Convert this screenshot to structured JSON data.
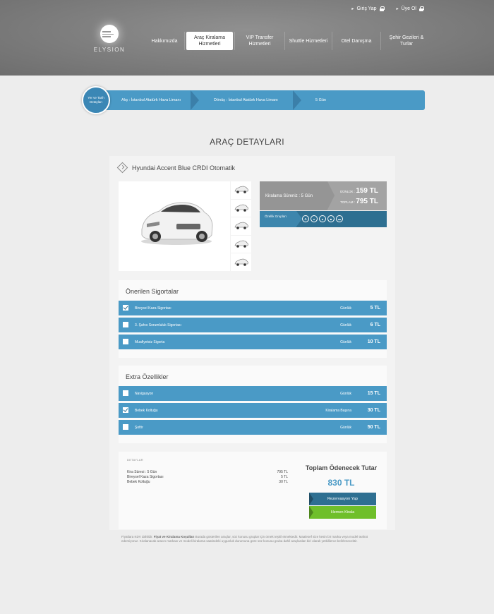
{
  "header": {
    "login": "Giriş Yap",
    "register": "Üye Ol",
    "logo_text": "ELYSION",
    "nav": [
      {
        "label": "Hakkımızda"
      },
      {
        "label": "Araç Kiralama Hizmetleri"
      },
      {
        "label": "VIP Transfer Hizmetleri"
      },
      {
        "label": "Shuttle Hizmetleri"
      },
      {
        "label": "Otel Danışma"
      },
      {
        "label": "Şehir Gezileri & Turlar"
      }
    ]
  },
  "steps": {
    "circle": "Yer ve Tarih Detayları",
    "departure": "Alış : İstanbul Atatürk Hava Limanı",
    "return": "Dönüş : İstanbul Atatürk Hava Limanı",
    "duration": "5 Gün"
  },
  "page_title": "ARAÇ DETAYLARI",
  "car": {
    "name": "Hyundai Accent Blue CRDI Otomatik",
    "rent_duration": "Kiralama Süreniz : 5 Gün",
    "daily_label": "GÜNLÜK :",
    "daily_price": "159 TL",
    "total_label": "TOPLAM :",
    "total_price": "795 TL",
    "feature_label": "Özellik Grupları",
    "feature_icons": [
      "gear-icon",
      "person-icon",
      "fuel-icon",
      "door-icon",
      "bag-icon"
    ]
  },
  "insurance": {
    "title": "Önerilen Sigortalar",
    "rows": [
      {
        "name": "Bireysel Kaza Sigortası",
        "period": "Günlük",
        "price": "5 TL",
        "checked": true
      },
      {
        "name": "3. Şahıs Sorumluluk Sigortası",
        "period": "Günlük",
        "price": "6 TL",
        "checked": false
      },
      {
        "name": "Muafiyetsiz Sigorta",
        "period": "Günlük",
        "price": "10 TL",
        "checked": false
      }
    ]
  },
  "extras": {
    "title": "Extra Özellikler",
    "rows": [
      {
        "name": "Navigasyon",
        "period": "Günlük",
        "price": "15 TL",
        "checked": false
      },
      {
        "name": "Bebek Koltuğu",
        "period": "Kiralama Başına",
        "price": "30 TL",
        "checked": true
      },
      {
        "name": "Şoför",
        "period": "Günlük",
        "price": "50 TL",
        "checked": false
      }
    ]
  },
  "summary": {
    "label": "DETAYLAR",
    "items": [
      {
        "name": "Kira Süresi : 5 Gün",
        "value": "795 TL"
      },
      {
        "name": "Bireysel Kaza Sigortası",
        "value": "5 TL"
      },
      {
        "name": "Bebek Koltuğu",
        "value": "30 TL"
      }
    ],
    "total_title": "Toplam Ödenecek Tutar",
    "total_value": "830 TL",
    "reserve_button": "Rezervasyon Yap",
    "rent_button": "Hemen Kirala"
  },
  "footer": {
    "prefix": "Fiyatlara KDV dahildir.",
    "bold": "Fiyat ve Kiralama Koşulları",
    "text": "Burada gösterilen araçlar, söz konusu gruplar için örnek teşkil etmektedir. Maalesef size kesin bir marka veya model teahüt edemiyoruz. Kiralanacak aracın markası ve modeli kiralama saatindeki uygunluk durumuna göre söz konusu gruba dahil araçlardan biri olarak yetkililerce belirlenecektir."
  }
}
